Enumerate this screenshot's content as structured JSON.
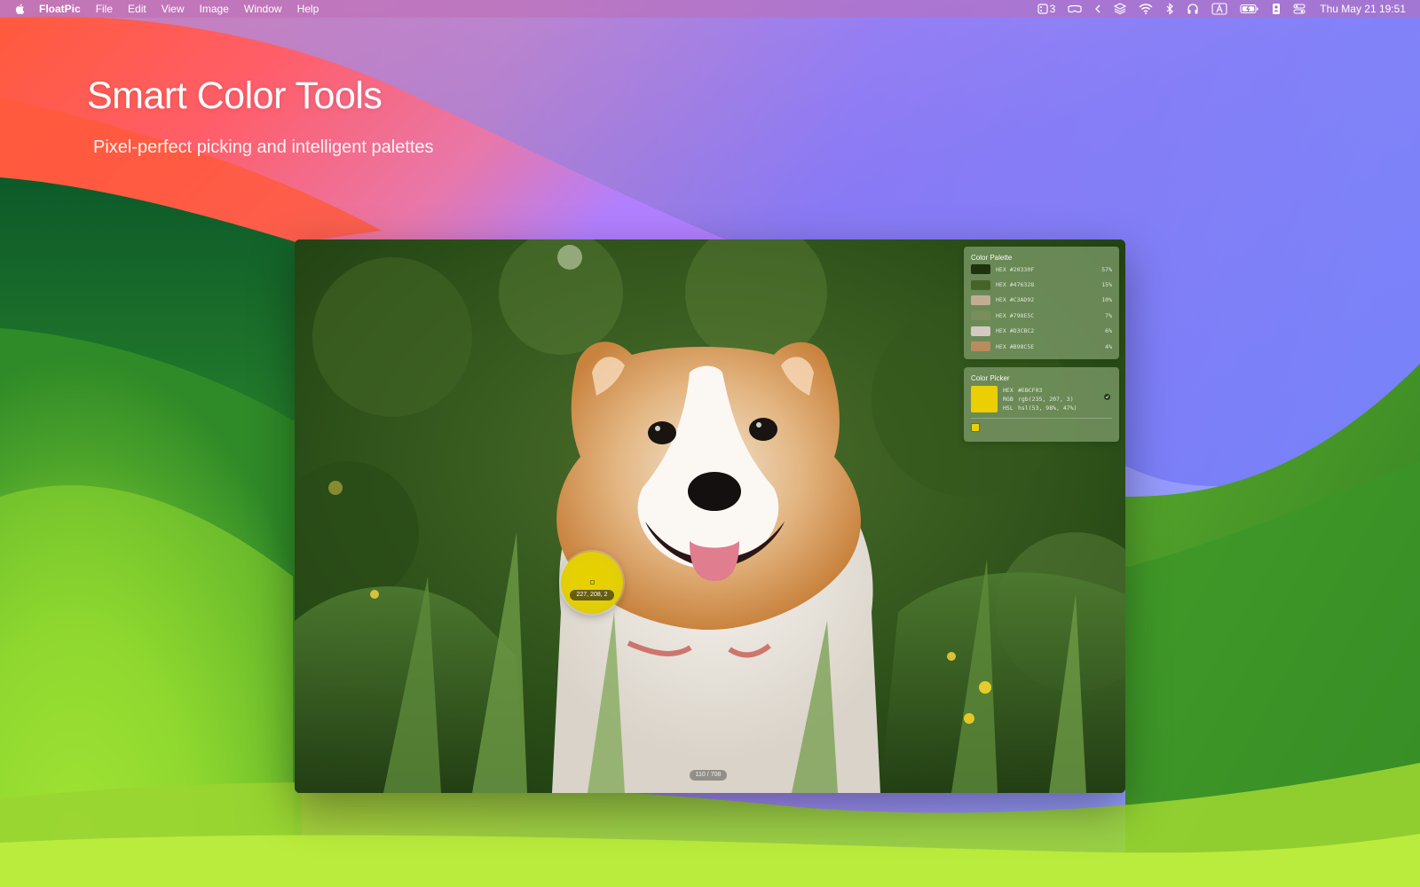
{
  "menubar": {
    "app_name": "FloatPic",
    "items": [
      "File",
      "Edit",
      "View",
      "Image",
      "Window",
      "Help"
    ],
    "status_badge": "3",
    "clock": "Thu May 21  19:51"
  },
  "hero": {
    "title": "Smart Color Tools",
    "subtitle": "Pixel-perfect picking and intelligent palettes"
  },
  "palette": {
    "title": "Color Palette",
    "hex_label": "HEX",
    "colors": [
      {
        "hex": "#20330F",
        "pct": "57%",
        "swatch": "#20330f"
      },
      {
        "hex": "#476328",
        "pct": "15%",
        "swatch": "#476328"
      },
      {
        "hex": "#C3AD92",
        "pct": "10%",
        "swatch": "#c3ad92"
      },
      {
        "hex": "#798E5C",
        "pct": "7%",
        "swatch": "#798e5c"
      },
      {
        "hex": "#D3CBC2",
        "pct": "6%",
        "swatch": "#d3cbc2"
      },
      {
        "hex": "#B98C5E",
        "pct": "4%",
        "swatch": "#b98c5e"
      }
    ]
  },
  "picker": {
    "title": "Color Picker",
    "hex_label": "HEX",
    "hex": "#EBCF03",
    "rgb_label": "RGB",
    "rgb": "rgb(235, 207, 3)",
    "hsl_label": "HSL",
    "hsl": "hsl(53, 98%, 47%)",
    "color": "#ebcf03"
  },
  "loupe": {
    "label": "227, 208, 2"
  },
  "viewer": {
    "page_counter": "110 / 708"
  }
}
